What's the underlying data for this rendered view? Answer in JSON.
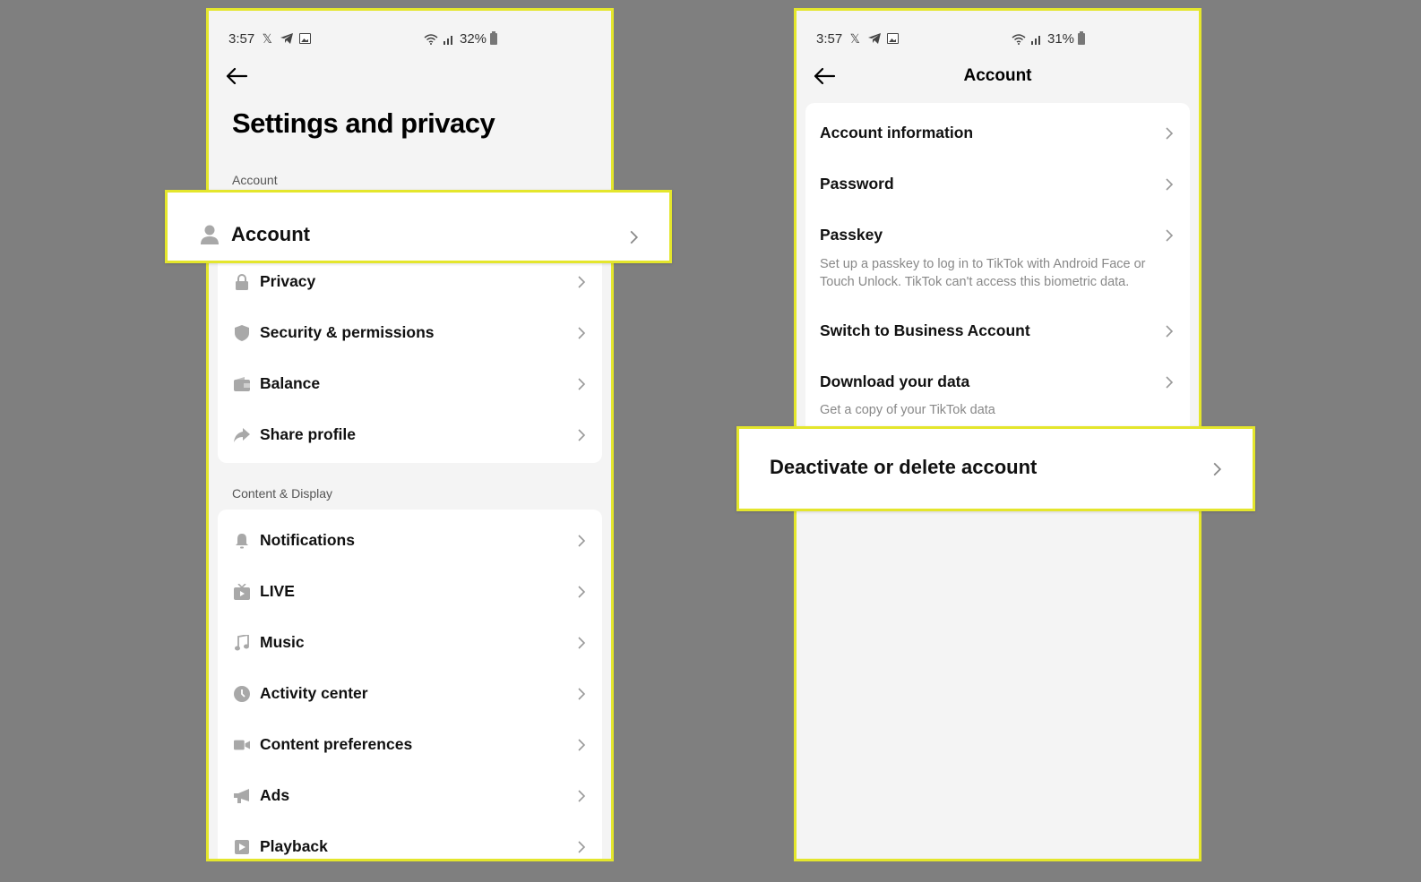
{
  "colors": {
    "background": "#7f7f7f",
    "highlight_border": "#e4e62c",
    "phone_bg": "#f4f4f4",
    "card_bg": "#ffffff",
    "icon_gray": "#a8a8a8"
  },
  "left_screen": {
    "status_bar": {
      "time": "3:57",
      "battery": "32%",
      "icons": [
        "x-logo-icon",
        "telegram-icon",
        "image-icon",
        "wifi-icon",
        "signal-icon",
        "battery-icon"
      ]
    },
    "back_icon": "arrow-left-icon",
    "title": "Settings and privacy",
    "sections": [
      {
        "label": "Account",
        "items": [
          {
            "label": "Account",
            "icon": "person-icon",
            "highlighted": true
          },
          {
            "label": "Privacy",
            "icon": "lock-icon"
          },
          {
            "label": "Security & permissions",
            "icon": "shield-icon"
          },
          {
            "label": "Balance",
            "icon": "wallet-icon"
          },
          {
            "label": "Share profile",
            "icon": "share-icon"
          }
        ]
      },
      {
        "label": "Content & Display",
        "items": [
          {
            "label": "Notifications",
            "icon": "bell-icon"
          },
          {
            "label": "LIVE",
            "icon": "tv-icon"
          },
          {
            "label": "Music",
            "icon": "music-note-icon"
          },
          {
            "label": "Activity center",
            "icon": "clock-icon"
          },
          {
            "label": "Content preferences",
            "icon": "video-camera-icon"
          },
          {
            "label": "Ads",
            "icon": "megaphone-icon"
          },
          {
            "label": "Playback",
            "icon": "play-icon"
          }
        ]
      }
    ]
  },
  "right_screen": {
    "status_bar": {
      "time": "3:57",
      "battery": "31%",
      "icons": [
        "x-logo-icon",
        "telegram-icon",
        "image-icon",
        "wifi-icon",
        "signal-icon",
        "battery-icon"
      ]
    },
    "back_icon": "arrow-left-icon",
    "title": "Account",
    "items": [
      {
        "label": "Account information"
      },
      {
        "label": "Password"
      },
      {
        "label": "Passkey",
        "subtitle": "Set up a passkey to log in to TikTok with Android Face or Touch Unlock. TikTok can't access this biometric data."
      },
      {
        "label": "Switch to Business Account"
      },
      {
        "label": "Download your data",
        "subtitle": "Get a copy of your TikTok data"
      },
      {
        "label": "Deactivate or delete account",
        "highlighted": true
      }
    ]
  }
}
